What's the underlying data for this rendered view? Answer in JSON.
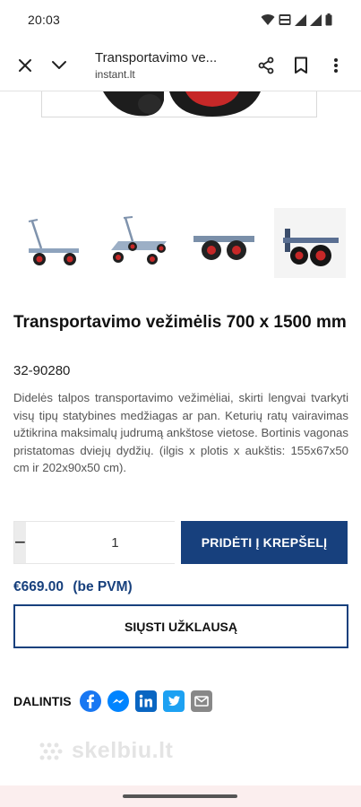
{
  "status_bar": {
    "time": "20:03",
    "volte_label": "Vo) LTE 2"
  },
  "browser": {
    "title": "Transportavimo ve...",
    "url": "instant.lt",
    "icons": [
      "close-icon",
      "chevron-down-icon",
      "share-icon",
      "bookmark-icon",
      "more-icon"
    ]
  },
  "product": {
    "title": "Transportavimo vežimėlis 700 x 1500 mm",
    "sku": "32-90280",
    "description": "Didelės talpos transportavimo vežimėliai, skirti lengvai tvarkyti visų tipų statybines medžiagas ar pan. Keturių ratų vairavimas užtikrina maksimalų judrumą ankštose vietose. Bortinis vagonas pristatomas dviejų dydžių. (ilgis x plotis x aukštis: 155x67x50 cm ir 202x90x50 cm).",
    "thumbnails": [
      "cart-side-view",
      "cart-angled-view",
      "cart-front-view",
      "cart-closeup-wheels"
    ],
    "selected_thumbnail": 3
  },
  "purchase": {
    "decrement_symbol": "−",
    "increment_symbol": "+",
    "quantity": "1",
    "add_to_cart_label": "PRIDĖTI Į KREPŠELĮ",
    "price": "€669.00",
    "price_note": "(be PVM)",
    "inquiry_label": "SIŲSTI UŽKLAUSĄ"
  },
  "share": {
    "label": "DALINTIS",
    "networks": [
      "facebook-icon",
      "messenger-icon",
      "linkedin-icon",
      "twitter-icon",
      "email-icon"
    ]
  },
  "watermark": "skelbiu.lt",
  "colors": {
    "brand_blue": "#17407d",
    "facebook": "#1877f2",
    "messenger": "#0084ff",
    "linkedin": "#0a66c2",
    "twitter": "#1da1f2",
    "email": "#888888"
  }
}
